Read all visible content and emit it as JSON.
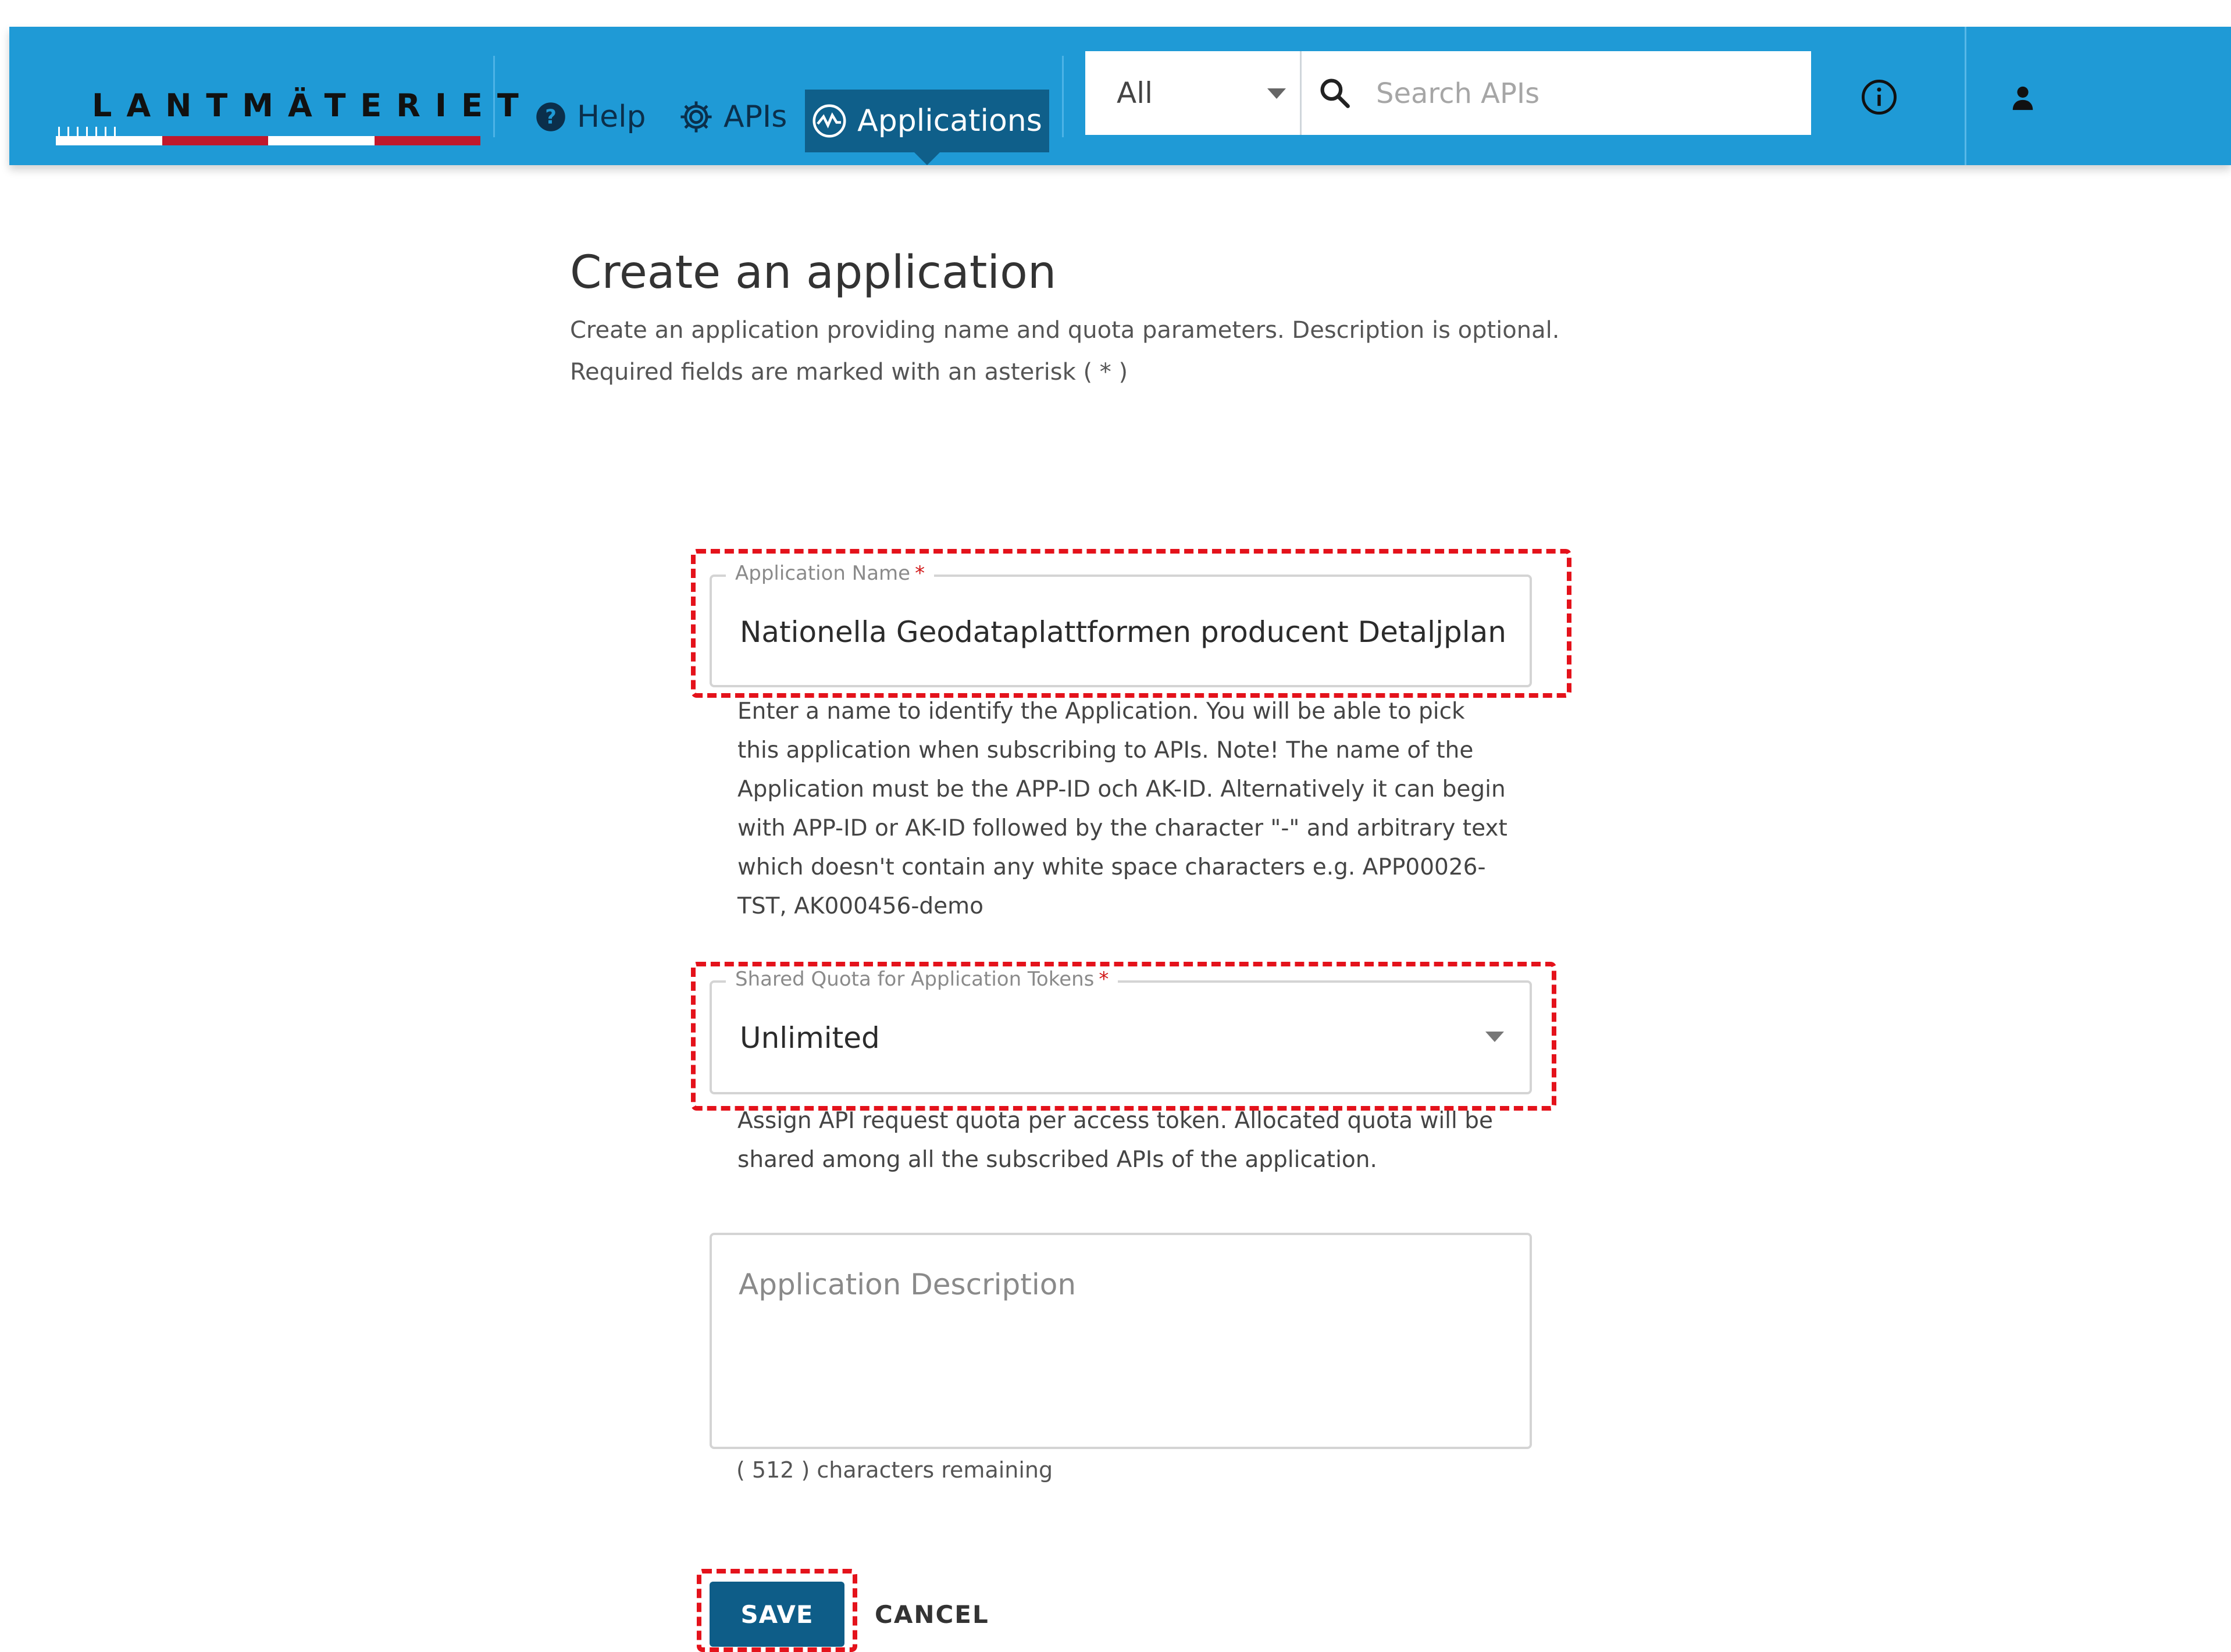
{
  "brand": {
    "logo_text": "LANTMÄTERIET",
    "header_color": "#1f9ad6",
    "active_nav_color": "#0f5f8a",
    "logo_red": "#c0182c"
  },
  "nav": {
    "items": [
      {
        "label": "Help",
        "icon": "question-circle-icon"
      },
      {
        "label": "APIs",
        "icon": "gear-icon"
      },
      {
        "label": "Applications",
        "icon": "activity-circle-icon",
        "active": true
      }
    ]
  },
  "search": {
    "scope_selected": "All",
    "placeholder": "Search APIs"
  },
  "header_icons": [
    "info-icon",
    "user-icon"
  ],
  "page": {
    "title": "Create an application",
    "description_line1": "Create an application providing name and quota parameters. Description is optional.",
    "description_line2": "Required fields are marked with an asterisk ( * )"
  },
  "form": {
    "application_name": {
      "label": "Application Name",
      "required_marker": "*",
      "value": "Nationella Geodataplattformen producent Detaljplan",
      "helper": "Enter a name to identify the Application. You will be able to pick this application when subscribing to APIs. Note! The name of the Application must be the APP-ID och AK-ID. Alternatively it can begin with APP-ID or AK-ID followed by the character \"-\" and arbitrary text which doesn't contain any white space characters e.g. APP00026-TST, AK000456-demo"
    },
    "shared_quota": {
      "label": "Shared Quota for Application Tokens",
      "required_marker": "*",
      "selected": "Unlimited",
      "helper": "Assign API request quota per access token. Allocated quota will be shared among all the subscribed APIs of the application."
    },
    "description": {
      "placeholder": "Application Description",
      "counter": "( 512 ) characters remaining"
    },
    "buttons": {
      "save": "SAVE",
      "cancel": "CANCEL"
    },
    "annotation_color": "#e4121b"
  }
}
